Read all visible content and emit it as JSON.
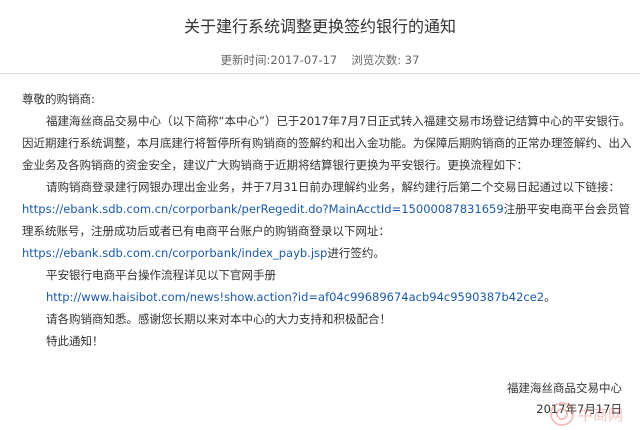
{
  "article": {
    "title": "关于建行系统调整更换签约银行的通知",
    "update_label": "更新时间:2017-07-17",
    "views_label": "浏览次数: 37"
  },
  "body": {
    "greeting": "尊敬的购销商:",
    "para1": "福建海丝商品交易中心（以下简称“本中心”）已于2017年7月7日正式转入福建交易市场登记结算中心的平安银行。因近期建行系统调整，本月底建行将暂停所有购销商的签解约和出入金功能。为保障后期购销商的正常办理签解约、出入金业务及各购销商的资金安全，建议广大购销商于近期将结算银行更换为平安银行。更换流程如下：",
    "para2_prefix": "请购销商登录建行网银办理出金业务，并于7月31日前办理解约业务，解约建行后第二个交易日起通过以下链接：",
    "link1": "https://ebank.sdb.com.cn/corporbank/perRegedit.do?MainAcctId=15000087831659",
    "para2_mid": "注册平安电商平台会员管理系统账号，注册成功后或者已有电商平台账户的购销商登录以下网址：",
    "link2": "https://ebank.sdb.com.cn/corporbank/index_payb.jsp",
    "para2_suffix": "进行签约。",
    "manual_line": "平安银行电商平台操作流程详见以下官网手册",
    "link3": "http://www.haisibot.com/news!show.action?id=af04c99689674acb94c9590387b42ce2",
    "link3_suffix": "。",
    "closing1": "请各购销商知悉。感谢您长期以来对本中心的大力支持和积极配合！",
    "closing2": "特此通知！"
  },
  "signature": {
    "org": "福建海丝商品交易中心",
    "date": "2017年7月17日"
  },
  "watermark": {
    "text": "中商网",
    "color": "#d9534f"
  }
}
